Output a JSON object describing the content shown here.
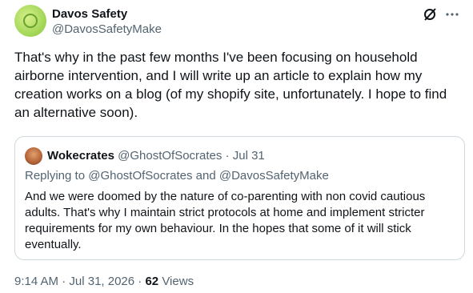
{
  "tweet": {
    "display_name": "Davos Safety",
    "handle": "@DavosSafetyMake",
    "text": "That's why in the past few months I've been focusing on household airborne intervention, and I will write up an article to explain how my creation works on a blog (of my shopify site, unfortunately. I hope to find an alternative soon).",
    "time": "9:14 AM",
    "date": "Jul 31, 2026",
    "views_count": "62",
    "views_label": "Views"
  },
  "quote": {
    "display_name": "Wokecrates",
    "handle": "@GhostOfSocrates",
    "date": "Jul 31",
    "replying_prefix": "Replying to",
    "replying_to_1": "@GhostOfSocrates",
    "replying_and": "and",
    "replying_to_2": "@DavosSafetyMake",
    "text": "And we were doomed by the nature of co-parenting with non covid cautious adults. That's why I maintain strict protocols at home and implement stricter requirements for my own behaviour. In the hopes that some of it will stick eventually."
  },
  "icons": {
    "grok": "grok-icon",
    "more": "more-icon"
  },
  "colors": {
    "text": "#0f1419",
    "secondary": "#536471",
    "border": "#cfd9de"
  }
}
